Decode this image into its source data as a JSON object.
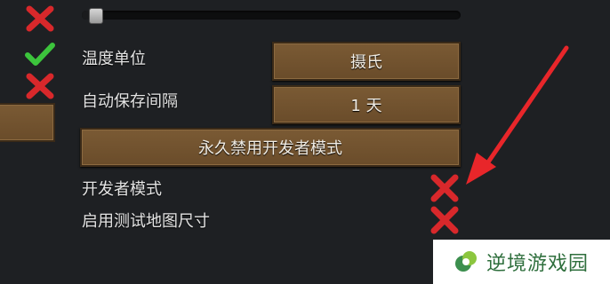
{
  "settings": {
    "slider": {
      "value": 0.02
    },
    "rows": [
      {
        "id": "temperature-unit",
        "label": "温度单位",
        "value": "摄氏"
      },
      {
        "id": "autosave-interval",
        "label": "自动保存间隔",
        "value": "1 天"
      }
    ],
    "disable_dev_button": "永久禁用开发者模式",
    "toggles": [
      {
        "id": "developer-mode",
        "label": "开发者模式",
        "checked": false
      },
      {
        "id": "test-map-sizes",
        "label": "启用测试地图尺寸",
        "checked": false
      }
    ],
    "left_column_icons": [
      "cross-icon",
      "check-icon",
      "cross-icon"
    ]
  },
  "annotation": {
    "arrow_color": "#e8262a"
  },
  "watermark": {
    "text": "逆境游戏园"
  },
  "colors": {
    "background": "#1e2023",
    "button": "#7a5a34",
    "cross": "#d8282b",
    "check": "#3cc43c",
    "watermark_text": "#2f6f3d"
  }
}
